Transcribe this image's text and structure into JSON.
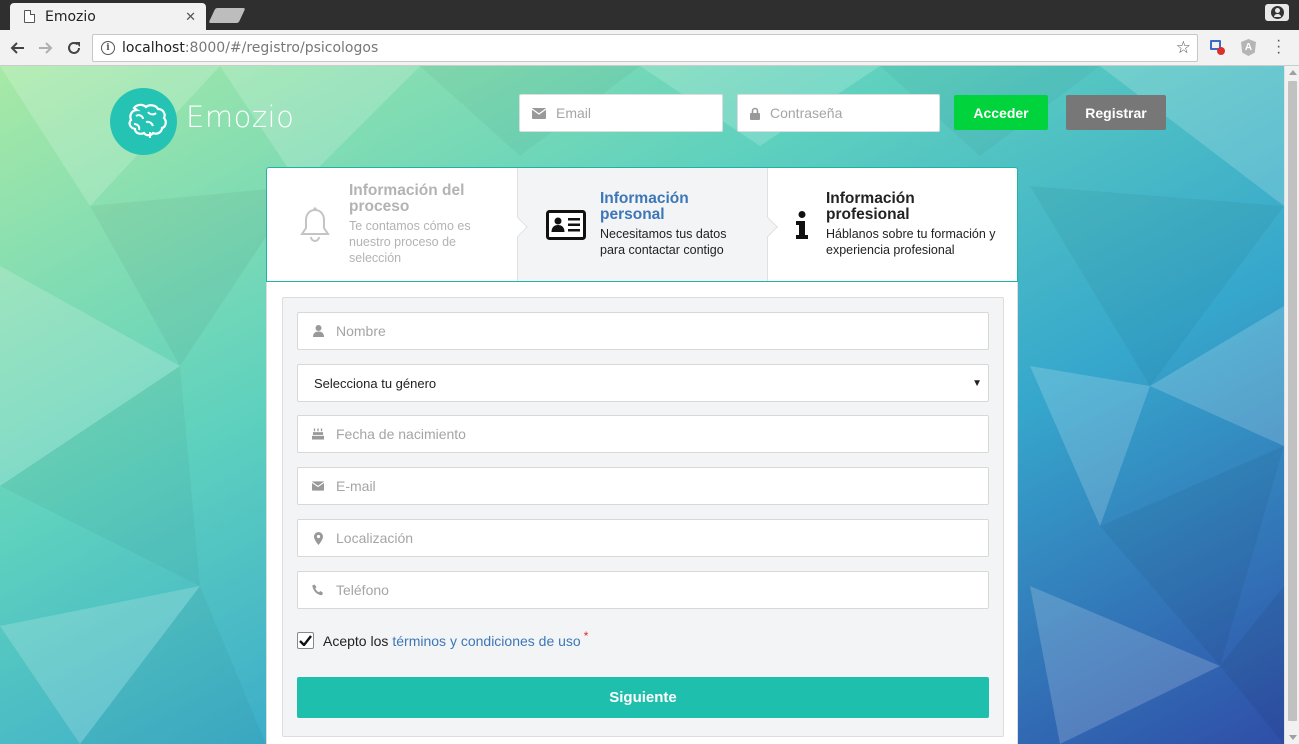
{
  "browser": {
    "tab_title": "Emozio",
    "url_host": "localhost",
    "url_path": ":8000/#/registro/psicologos",
    "close_glyph": "✕"
  },
  "header": {
    "brand": "Emozio",
    "email_placeholder": "Email",
    "password_placeholder": "Contraseña",
    "login_label": "Acceder",
    "register_label": "Registrar"
  },
  "steps": [
    {
      "title": "Información del proceso",
      "desc": "Te contamos cómo es nuestro proceso de selección",
      "icon": "bell-icon",
      "state": "done"
    },
    {
      "title": "Información personal",
      "desc": "Necesitamos tus datos para contactar contigo",
      "icon": "id-card-icon",
      "state": "active"
    },
    {
      "title": "Información profesional",
      "desc": "Háblanos sobre tu formación y experiencia profesional",
      "icon": "info-icon",
      "state": "pending"
    }
  ],
  "form": {
    "nombre_placeholder": "Nombre",
    "genero_selected": "Selecciona tu género",
    "fecha_placeholder": "Fecha de nacimiento",
    "email_placeholder": "E-mail",
    "localizacion_placeholder": "Localización",
    "telefono_placeholder": "Teléfono",
    "terms_checked": true,
    "terms_prefix": "Acepto los",
    "terms_link": "términos y condiciones de uso",
    "terms_required_mark": "*",
    "submit_label": "Siguiente"
  },
  "colors": {
    "accent": "#1fbfae",
    "login_green": "#00d33b",
    "register_gray": "#777777",
    "link_blue": "#3d77b8"
  }
}
